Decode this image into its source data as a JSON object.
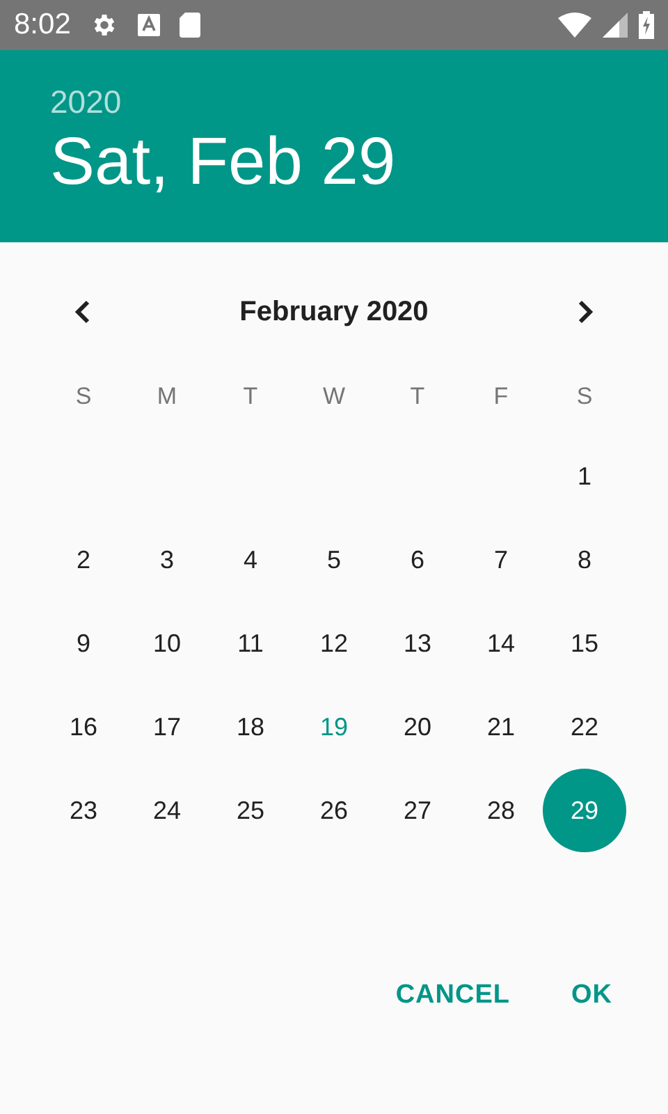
{
  "status_bar": {
    "time": "8:02"
  },
  "header": {
    "year": "2020",
    "date": "Sat, Feb 29"
  },
  "calendar": {
    "month": "February 2020",
    "weekdays": [
      "S",
      "M",
      "T",
      "W",
      "T",
      "F",
      "S"
    ],
    "weeks": [
      {
        "days": [
          {
            "label": "1",
            "selected": false,
            "today": false
          }
        ]
      },
      {
        "days": [
          {
            "label": "2",
            "selected": false,
            "today": false
          },
          {
            "label": "3",
            "selected": false,
            "today": false
          },
          {
            "label": "4",
            "selected": false,
            "today": false
          },
          {
            "label": "5",
            "selected": false,
            "today": false
          },
          {
            "label": "6",
            "selected": false,
            "today": false
          },
          {
            "label": "7",
            "selected": false,
            "today": false
          },
          {
            "label": "8",
            "selected": false,
            "today": false
          }
        ]
      },
      {
        "days": [
          {
            "label": "9",
            "selected": false,
            "today": false
          },
          {
            "label": "10",
            "selected": false,
            "today": false
          },
          {
            "label": "11",
            "selected": false,
            "today": false
          },
          {
            "label": "12",
            "selected": false,
            "today": false
          },
          {
            "label": "13",
            "selected": false,
            "today": false
          },
          {
            "label": "14",
            "selected": false,
            "today": false
          },
          {
            "label": "15",
            "selected": false,
            "today": false
          }
        ]
      },
      {
        "days": [
          {
            "label": "16",
            "selected": false,
            "today": false
          },
          {
            "label": "17",
            "selected": false,
            "today": false
          },
          {
            "label": "18",
            "selected": false,
            "today": false
          },
          {
            "label": "19",
            "selected": false,
            "today": true
          },
          {
            "label": "20",
            "selected": false,
            "today": false
          },
          {
            "label": "21",
            "selected": false,
            "today": false
          },
          {
            "label": "22",
            "selected": false,
            "today": false
          }
        ]
      },
      {
        "days": [
          {
            "label": "23",
            "selected": false,
            "today": false
          },
          {
            "label": "24",
            "selected": false,
            "today": false
          },
          {
            "label": "25",
            "selected": false,
            "today": false
          },
          {
            "label": "26",
            "selected": false,
            "today": false
          },
          {
            "label": "27",
            "selected": false,
            "today": false
          },
          {
            "label": "28",
            "selected": false,
            "today": false
          },
          {
            "label": "29",
            "selected": true,
            "today": false
          }
        ]
      }
    ]
  },
  "buttons": [
    "CANCEL",
    "OK"
  ]
}
